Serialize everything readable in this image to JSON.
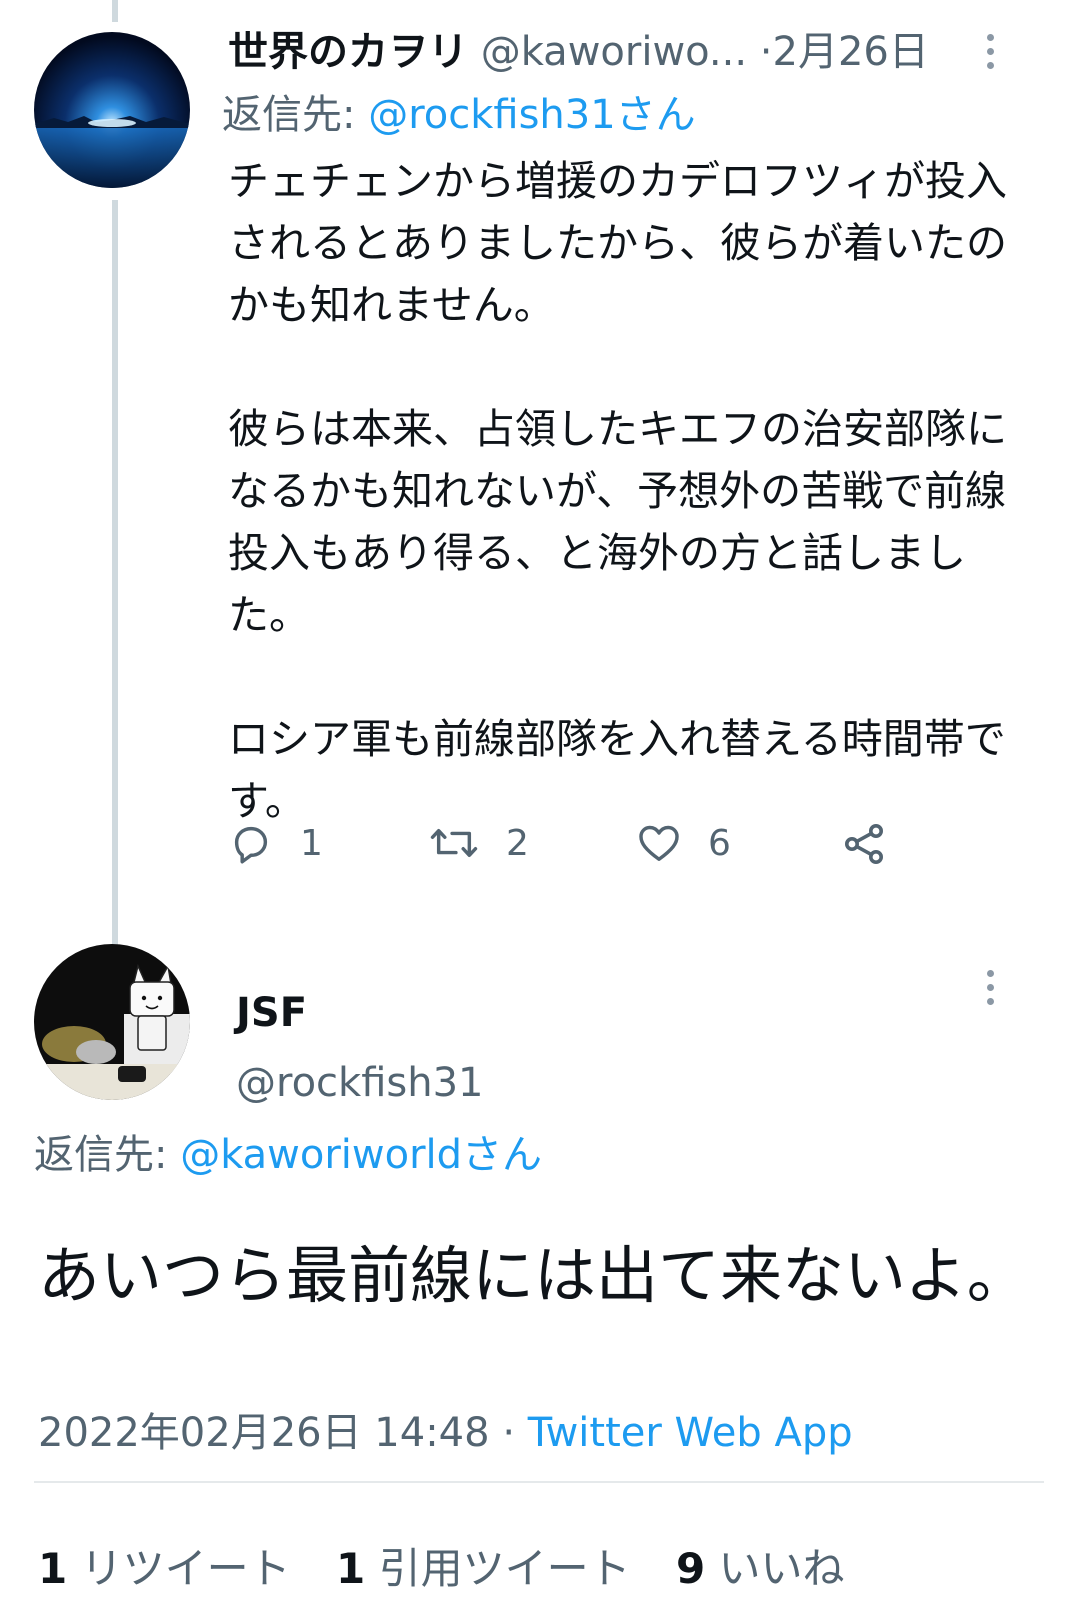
{
  "tweet1": {
    "display_name": "世界のカヲリ",
    "handle": "@kaworiwo...",
    "separator": "·",
    "date": "2月26日",
    "reply_prefix": "返信先: ",
    "reply_to": "@rockfish31さん",
    "paragraphs": [
      "チェチェンから増援のカデロフツィが投入されるとありましたから、彼らが着いたのかも知れません。",
      "彼らは本来、占領したキエフの治安部隊になるかも知れないが、予想外の苦戦で前線投入もあり得る、と海外の方と話しました。",
      "ロシア軍も前線部隊を入れ替える時間帯です。"
    ],
    "actions": {
      "reply_count": "1",
      "retweet_count": "2",
      "like_count": "6"
    }
  },
  "tweet2": {
    "display_name": "JSF",
    "handle": "@rockfish31",
    "reply_prefix": "返信先: ",
    "reply_to": "@kaworiworldさん",
    "text": "あいつら最前線には出て来ないよ。",
    "timestamp": "2022年02月26日 14:48",
    "separator": "·",
    "source": "Twitter Web App",
    "stats": {
      "retweets_num": "1",
      "retweets_label": "リツイート",
      "quotes_num": "1",
      "quotes_label": "引用ツイート",
      "likes_num": "9",
      "likes_label": "いいね"
    }
  },
  "colors": {
    "text": "#0f1419",
    "secondary": "#536471",
    "link": "#1d9bf0",
    "thread_line": "#cfd9de"
  },
  "icons": [
    "more-icon",
    "reply-icon",
    "retweet-icon",
    "like-icon",
    "share-icon"
  ]
}
